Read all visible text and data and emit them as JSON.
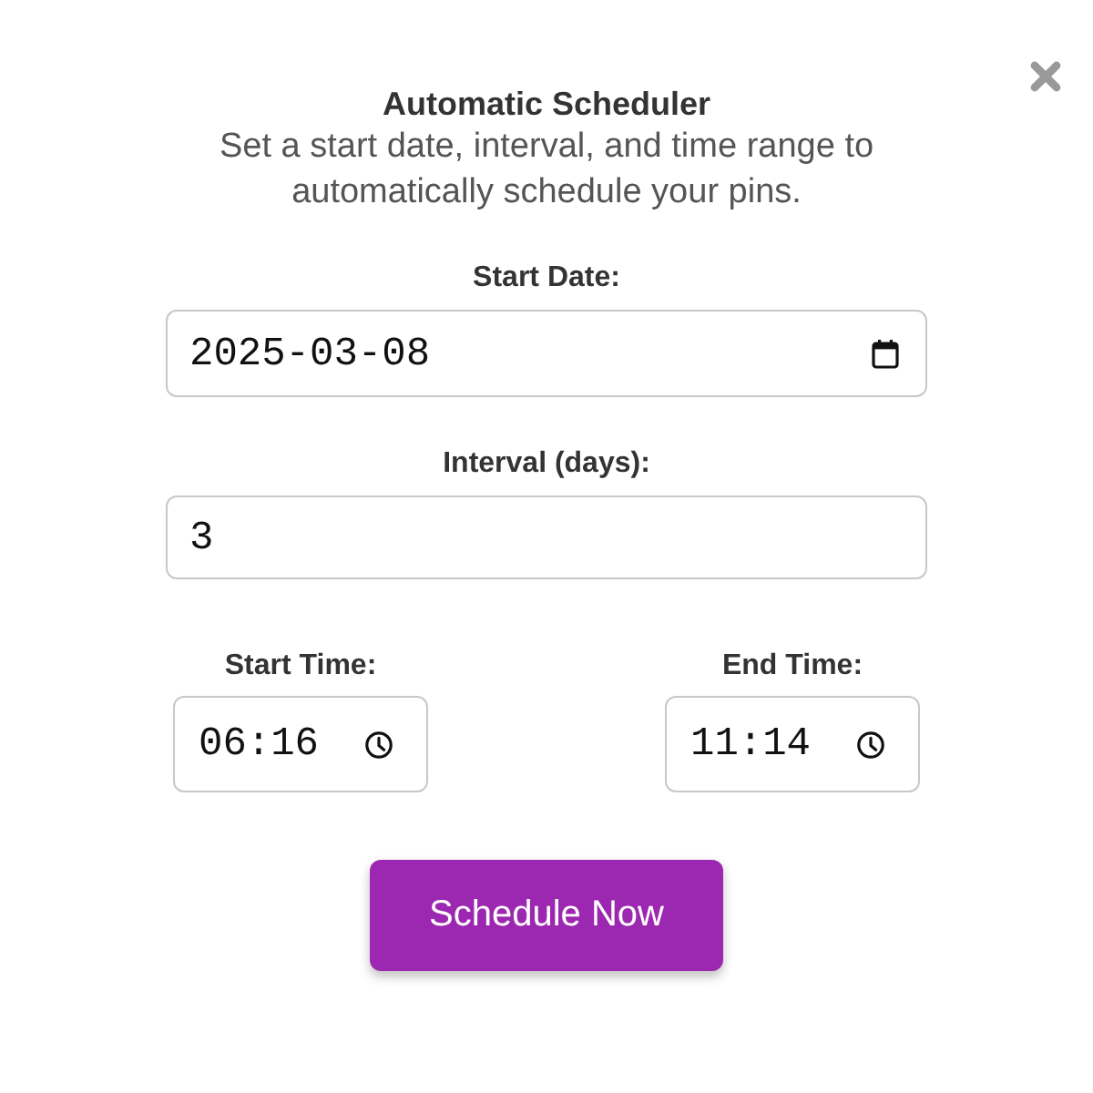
{
  "dialog": {
    "title": "Automatic Scheduler",
    "description": "Set a start date, interval, and time range to automatically schedule your pins."
  },
  "fields": [
    {
      "kind": "date",
      "label": "Start Date:",
      "value": "2025-03-08"
    },
    {
      "kind": "number",
      "label": "Interval (days):",
      "value": "3"
    }
  ],
  "time_range": [
    {
      "label": "Start Time:",
      "value": "06:16"
    },
    {
      "label": "End Time:",
      "value": "11:14"
    }
  ],
  "button": "Schedule Now"
}
